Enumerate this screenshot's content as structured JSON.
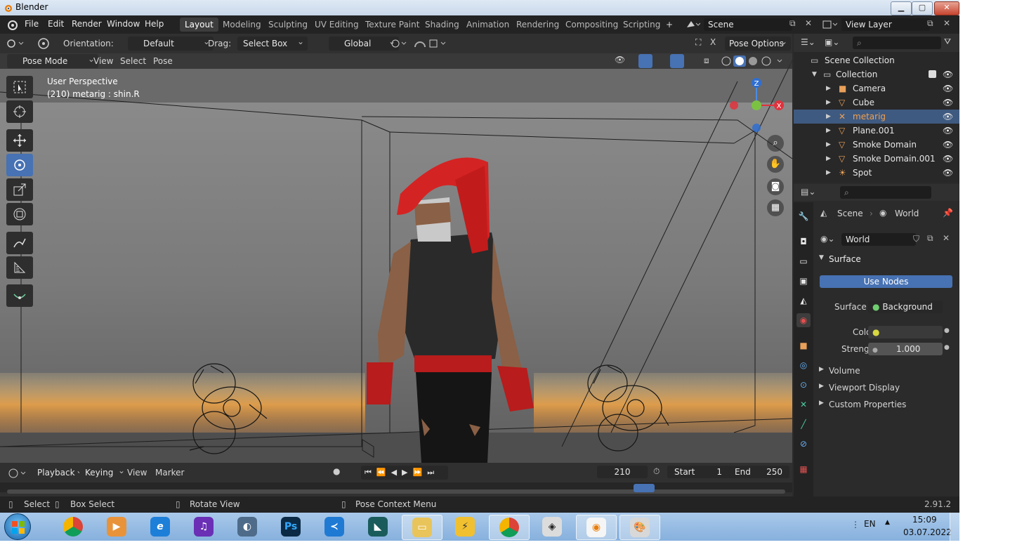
{
  "app": {
    "title": "Blender",
    "version": "2.91.2"
  },
  "menu": [
    "File",
    "Edit",
    "Render",
    "Window",
    "Help"
  ],
  "workspaces": [
    "Layout",
    "Modeling",
    "Sculpting",
    "UV Editing",
    "Texture Paint",
    "Shading",
    "Animation",
    "Rendering",
    "Compositing",
    "Scripting"
  ],
  "active_workspace": "Layout",
  "scene": {
    "name": "Scene",
    "view_layer": "View Layer"
  },
  "header": {
    "orientation_label": "Orientation:",
    "orientation_value": "Default",
    "drag_label": "Drag:",
    "drag_value": "Select Box",
    "transform_space": "Global",
    "pose_options": "Pose Options"
  },
  "viewport_header": {
    "mode": "Pose Mode",
    "view": "View",
    "select": "Select",
    "pose": "Pose"
  },
  "viewport": {
    "perspective": "User Perspective",
    "info": "(210) metarig : shin.R"
  },
  "gizmo": {
    "z": "Z",
    "x": "X"
  },
  "timeline": {
    "playback": "Playback",
    "keying": "Keying",
    "view": "View",
    "marker": "Marker",
    "current_frame": "210",
    "start_label": "Start",
    "start": "1",
    "end_label": "End",
    "end": "250"
  },
  "status": {
    "select": "Select",
    "box_select": "Box Select",
    "rotate_view": "Rotate View",
    "pose_context": "Pose Context Menu"
  },
  "outliner": {
    "root": "Scene Collection",
    "collection": "Collection",
    "items": [
      "Camera",
      "Cube",
      "metarig",
      "Plane.001",
      "Smoke Domain",
      "Smoke Domain.001",
      "Spot"
    ],
    "selected": "metarig"
  },
  "properties": {
    "breadcrumb_scene": "Scene",
    "breadcrumb_world": "World",
    "world_name": "World",
    "surface_panel": "Surface",
    "use_nodes": "Use Nodes",
    "surface_label": "Surface",
    "surface_value": "Background",
    "color_label": "Color",
    "strength_label": "Strength",
    "strength_value": "1.000",
    "volume_panel": "Volume",
    "viewport_display_panel": "Viewport Display",
    "custom_props_panel": "Custom Properties"
  },
  "taskbar": {
    "language": "EN",
    "time": "15:09",
    "date": "03.07.2022"
  },
  "colors": {
    "accent": "#4772b3",
    "selected_row": "#3f5a80",
    "header": "#303030",
    "hair": "#d42323"
  }
}
